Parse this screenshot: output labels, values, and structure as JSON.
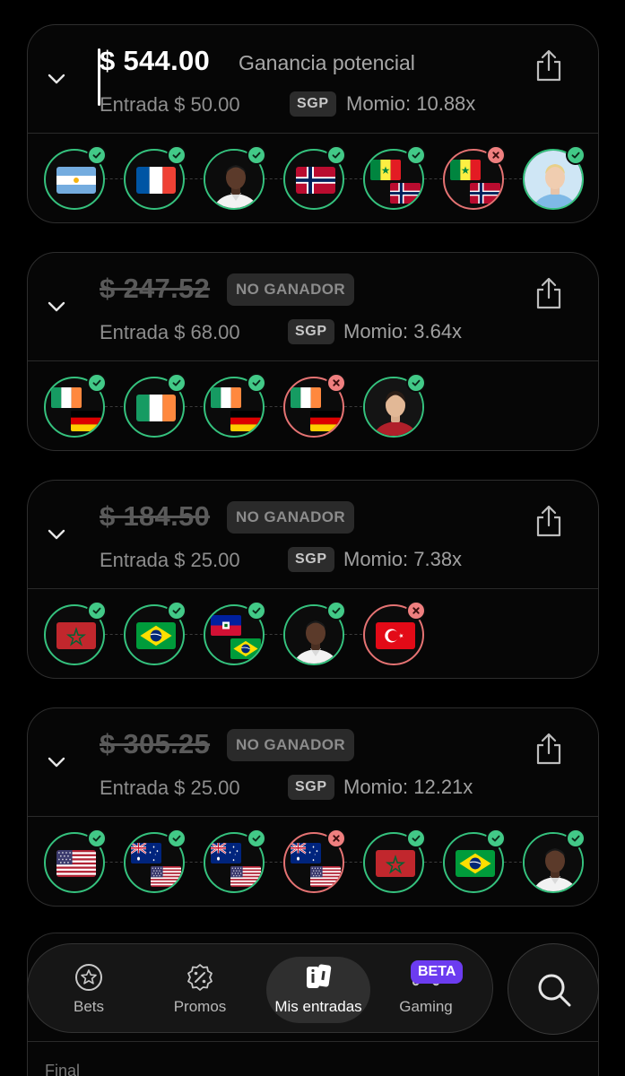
{
  "colors": {
    "won": "#35c27e",
    "lost": "#e57373",
    "accent": "#6c3cf0",
    "background": "#000000"
  },
  "cards": [
    {
      "amount": "$ 544.00",
      "label": "Ganancia potencial",
      "entry": "Entrada $ 50.00",
      "sgp": "SGP",
      "momio": "Momio: 10.88x",
      "legs": [
        {
          "type": "flag",
          "flags": [
            "argentina"
          ],
          "status": "won"
        },
        {
          "type": "flag",
          "flags": [
            "france"
          ],
          "status": "won"
        },
        {
          "type": "player",
          "player": "player-white-kit",
          "status": "won"
        },
        {
          "type": "flag",
          "flags": [
            "norway"
          ],
          "status": "won"
        },
        {
          "type": "flag",
          "flags": [
            "senegal",
            "norway"
          ],
          "status": "won"
        },
        {
          "type": "flag",
          "flags": [
            "senegal",
            "norway"
          ],
          "status": "lost"
        },
        {
          "type": "player",
          "player": "player-blue-kit",
          "status": "won"
        }
      ]
    },
    {
      "amount": "$ 247.52",
      "label": "NO GANADOR",
      "entry": "Entrada $ 68.00",
      "sgp": "SGP",
      "momio": "Momio: 3.64x",
      "legs": [
        {
          "type": "flag",
          "flags": [
            "ireland",
            "germany"
          ],
          "status": "won"
        },
        {
          "type": "flag",
          "flags": [
            "ireland"
          ],
          "status": "won"
        },
        {
          "type": "flag",
          "flags": [
            "ireland",
            "germany"
          ],
          "status": "won"
        },
        {
          "type": "flag",
          "flags": [
            "ireland",
            "germany"
          ],
          "status": "lost"
        },
        {
          "type": "player",
          "player": "player-red-kit",
          "status": "won"
        }
      ]
    },
    {
      "amount": "$ 184.50",
      "label": "NO GANADOR",
      "entry": "Entrada $ 25.00",
      "sgp": "SGP",
      "momio": "Momio: 7.38x",
      "legs": [
        {
          "type": "flag",
          "flags": [
            "morocco"
          ],
          "status": "won"
        },
        {
          "type": "flag",
          "flags": [
            "brazil"
          ],
          "status": "won"
        },
        {
          "type": "flag",
          "flags": [
            "haiti",
            "brazil"
          ],
          "status": "won"
        },
        {
          "type": "player",
          "player": "player-white-kit",
          "status": "won"
        },
        {
          "type": "flag",
          "flags": [
            "turkey"
          ],
          "status": "lost"
        }
      ]
    },
    {
      "amount": "$ 305.25",
      "label": "NO GANADOR",
      "entry": "Entrada $ 25.00",
      "sgp": "SGP",
      "momio": "Momio: 12.21x",
      "legs": [
        {
          "type": "flag",
          "flags": [
            "usa"
          ],
          "status": "won"
        },
        {
          "type": "flag",
          "flags": [
            "australia",
            "usa"
          ],
          "status": "won"
        },
        {
          "type": "flag",
          "flags": [
            "australia",
            "usa"
          ],
          "status": "won"
        },
        {
          "type": "flag",
          "flags": [
            "australia",
            "usa"
          ],
          "status": "lost"
        },
        {
          "type": "flag",
          "flags": [
            "morocco"
          ],
          "status": "won"
        },
        {
          "type": "flag",
          "flags": [
            "brazil"
          ],
          "status": "won"
        },
        {
          "type": "player",
          "player": "player-white-kit",
          "status": "won"
        }
      ]
    }
  ],
  "bottom_card": {
    "final_label": "Final"
  },
  "nav": {
    "items": [
      {
        "label": "Bets",
        "icon": "star-badge-icon"
      },
      {
        "label": "Promos",
        "icon": "percent-badge-icon"
      },
      {
        "label": "Mis entradas",
        "icon": "tickets-icon",
        "active": true
      },
      {
        "label": "Gaming",
        "icon": "gamepad-icon"
      }
    ],
    "beta": "BETA",
    "search_icon": "search-icon"
  }
}
